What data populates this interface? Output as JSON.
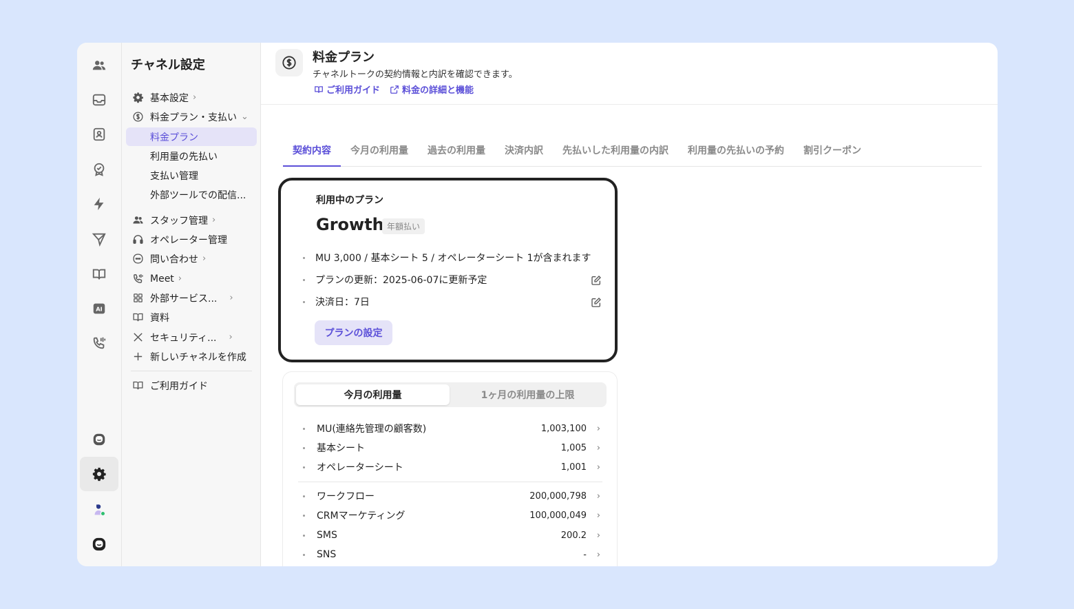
{
  "rail": {
    "items": [
      {
        "icon": "users-icon"
      },
      {
        "icon": "inbox-icon"
      },
      {
        "icon": "contact-book-icon"
      },
      {
        "icon": "badge-check-icon"
      },
      {
        "icon": "lightning-icon"
      },
      {
        "icon": "send-icon"
      },
      {
        "icon": "book-open-icon"
      },
      {
        "icon": "ai-icon",
        "label": "AI"
      },
      {
        "icon": "phone-icon"
      },
      {
        "icon": "chat-bubble-icon"
      },
      {
        "icon": "gear-icon"
      },
      {
        "icon": "avatar-icon"
      },
      {
        "icon": "channel-logo-icon"
      }
    ]
  },
  "settings_nav": {
    "title": "チャネル設定",
    "items": [
      {
        "label": "基本設定",
        "icon": "gear-icon",
        "chevron": "›"
      },
      {
        "label": "料金プラン・支払い",
        "icon": "dollar-icon",
        "chevron": "⌄"
      },
      {
        "label": "料金プラン"
      },
      {
        "label": "利用量の先払い"
      },
      {
        "label": "支払い管理"
      },
      {
        "label": "外部ツールでの配信..."
      },
      {
        "label": "スタッフ管理",
        "icon": "users-icon",
        "chevron": "›"
      },
      {
        "label": "オペレーター管理",
        "icon": "headset-icon"
      },
      {
        "label": "問い合わせ",
        "icon": "chat-icon",
        "chevron": "›"
      },
      {
        "label": "Meet",
        "icon": "phone-icon",
        "chevron": "›"
      },
      {
        "label": "外部サービス...",
        "icon": "grid-icon",
        "chevron": "›"
      },
      {
        "label": "資料",
        "icon": "book-icon"
      },
      {
        "label": "セキュリティ...",
        "icon": "tools-icon",
        "chevron": "›"
      },
      {
        "label": "新しいチャネルを作成",
        "icon": "plus-icon"
      },
      {
        "label": "ご利用ガイド",
        "icon": "book-icon"
      }
    ]
  },
  "header": {
    "title": "料金プラン",
    "subtitle": "チャネルトークの契約情報と内訳を確認できます。",
    "links": [
      {
        "label": "ご利用ガイド",
        "icon": "book-icon"
      },
      {
        "label": "料金の詳細と機能",
        "icon": "external-link-icon"
      }
    ]
  },
  "tabs": [
    "契約内容",
    "今月の利用量",
    "過去の利用量",
    "決済内訳",
    "先払いした利用量の内訳",
    "利用量の先払いの予約",
    "割引クーポン"
  ],
  "plan": {
    "label": "利用中のプラン",
    "name": "Growth",
    "badge": "年額払い",
    "items": [
      "MU 3,000 / 基本シート 5 / オペレーターシート 1が含まれます",
      "プランの更新：2025-06-07に更新予定",
      "決済日：7日"
    ],
    "button": "プランの設定"
  },
  "usage": {
    "segments": [
      "今月の利用量",
      "1ヶ月の利用量の上限"
    ],
    "rows": [
      {
        "label": "MU(連絡先管理の顧客数)",
        "value": "1,003,100"
      },
      {
        "label": "基本シート",
        "value": "1,005"
      },
      {
        "label": "オペレーターシート",
        "value": "1,001"
      },
      {
        "label": "ワークフロー",
        "value": "200,000,798"
      },
      {
        "label": "CRMマーケティング",
        "value": "100,000,049"
      },
      {
        "label": "SMS",
        "value": "200.2"
      },
      {
        "label": "SNS",
        "value": "-"
      }
    ]
  },
  "colors": {
    "accent": "#5b4fd8",
    "accent_bg": "#e5e3f8",
    "page_bg": "#d9e6fd"
  }
}
